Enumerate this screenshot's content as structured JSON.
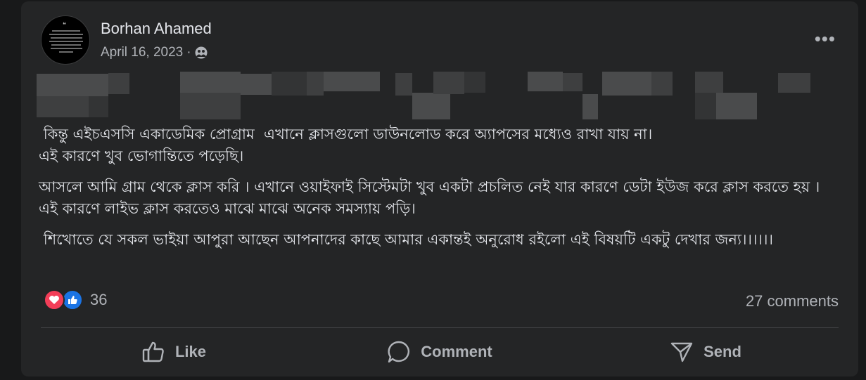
{
  "post": {
    "author": "Borhan Ahamed",
    "date": "April 16, 2023",
    "separator": "·",
    "audience_icon": "friends-icon",
    "more_icon": "more-icon",
    "paragraphs": [
      " কিন্তু এইচএসসি একাডেমিক প্রোগ্রাম  এখানে ক্লাসগুলো ডাউনলোড করে অ্যাপসের মধ্যেও রাখা যায় না। \nএই কারণে খুব ভোগান্তিতে পড়েছি।",
      "আসলে আমি গ্রাম থেকে ক্লাস করি । এখানে ওয়াইফাই সিস্টেমটা খুব একটা প্রচলিত নেই যার কারণে ডেটা ইউজ করে ক্লাস করতে হয় । এই কারণে লাইভ ক্লাস করতেও মাঝে মাঝে অনেক সমস্যায় পড়ি।",
      " শিখোতে যে সকল ভাইয়া আপুরা আছেন আপনাদের কাছে আমার একান্তই অনুরোধ রইলো এই বিষয়টি একটু দেখার জন্য।।।।।।"
    ]
  },
  "engagement": {
    "reaction_count": "36",
    "comments": "27 comments"
  },
  "actions": {
    "like": "Like",
    "comment": "Comment",
    "send": "Send"
  },
  "colors": {
    "background": "#18191a",
    "card": "#242526",
    "text": "#e4e6eb",
    "secondary": "#b0b3b8",
    "love": "#f33e58",
    "like": "#1b74e4"
  }
}
